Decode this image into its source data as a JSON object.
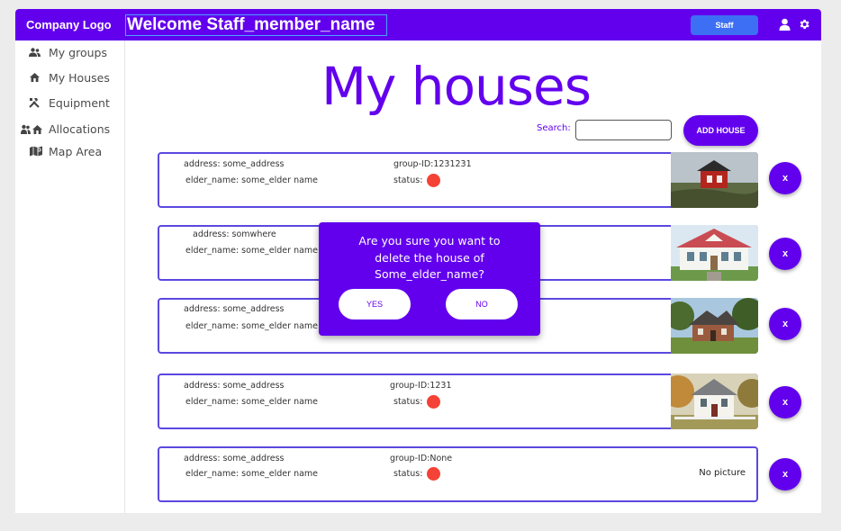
{
  "colors": {
    "primary": "#6200ee",
    "staff_button": "#3d6ff5",
    "card_border": "#5b48e0",
    "status_red": "#f44336"
  },
  "header": {
    "logo": "Company Logo",
    "welcome": "Welcome Staff_member_name",
    "staff_button": "Staff",
    "icons": [
      "person-icon",
      "gear-icon"
    ]
  },
  "sidebar": {
    "items": [
      {
        "label": "My groups",
        "icon": "group-icon"
      },
      {
        "label": "My Houses",
        "icon": "home-icon"
      },
      {
        "label": "Equipment",
        "icon": "tools-icon"
      },
      {
        "label": "Allocations",
        "icon": "allocation-icon"
      },
      {
        "label": "Map Area",
        "icon": "map-icon"
      }
    ]
  },
  "main": {
    "title": "My houses",
    "search_label": "Search:",
    "search_value": "",
    "add_button": "ADD HOUSE",
    "delete_label": "x"
  },
  "houses": [
    {
      "address": "address: some_address",
      "elder": "elder_name: some_elder name",
      "group": "group-ID:1231231",
      "status_label": "status:",
      "picture": "red-cabin"
    },
    {
      "address": "address: somwhere",
      "elder": "elder_name: some_elder name",
      "group": "",
      "status_label": "",
      "picture": "white-cottage"
    },
    {
      "address": "address: some_address",
      "elder": "elder_name: some_elder name",
      "group": "",
      "status_label": "",
      "picture": "brick-house"
    },
    {
      "address": "address: some_address",
      "elder": "elder_name: some_elder name",
      "group": "group-ID:1231",
      "status_label": "status:",
      "picture": "white-farmhouse"
    },
    {
      "address": "address: some_address",
      "elder": "elder_name: some_elder name",
      "group": "group-ID:None",
      "status_label": "status:",
      "picture": "No picture"
    }
  ],
  "modal": {
    "lines": [
      "Are you sure you want to",
      "delete the house of",
      "Some_elder_name?"
    ],
    "yes": "YES",
    "no": "NO"
  }
}
